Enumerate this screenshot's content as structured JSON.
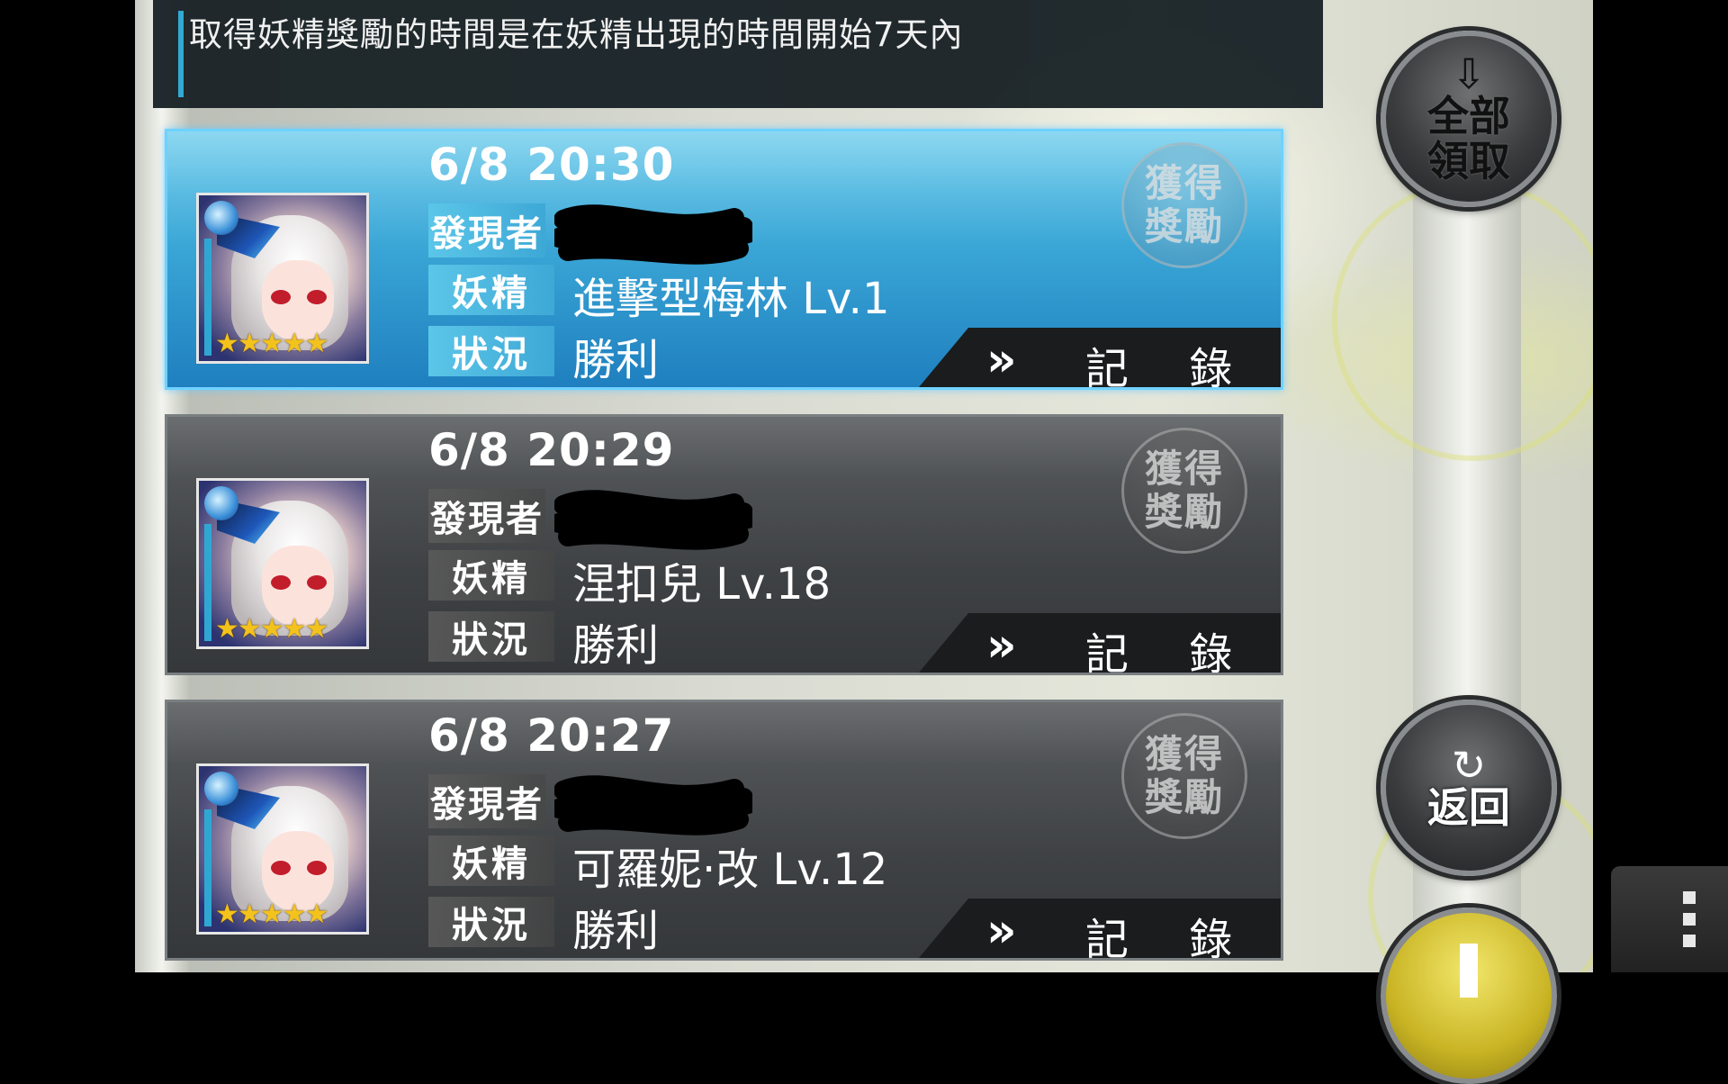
{
  "info": {
    "notice": "取得妖精獎勵的時間是在妖精出現的時間開始7天內"
  },
  "labels": {
    "finder": "發現者",
    "fairy": "妖精",
    "status": "狀況",
    "reward": "獲得獎勵",
    "record": "記 錄",
    "record_chevron": "»"
  },
  "records": [
    {
      "time": "6/8 20:30",
      "fairy": "進擊型梅林 Lv.1",
      "status": "勝利",
      "stars": "★★★★★",
      "selected": true
    },
    {
      "time": "6/8 20:29",
      "fairy": "涅扣兒 Lv.18",
      "status": "勝利",
      "stars": "★★★★★",
      "selected": false
    },
    {
      "time": "6/8 20:27",
      "fairy": "可羅妮·改 Lv.12",
      "status": "勝利",
      "stars": "★★★★★",
      "selected": false
    }
  ],
  "side_buttons": {
    "collect_all": "全部領取",
    "collect_all_icon": "arrow-down-icon",
    "back": "返回",
    "back_icon": "refresh-icon"
  },
  "colors": {
    "accent_blue": "#2fa7d3",
    "selected_card": "#3aa6d6",
    "star_gold": "#f3c21c"
  }
}
